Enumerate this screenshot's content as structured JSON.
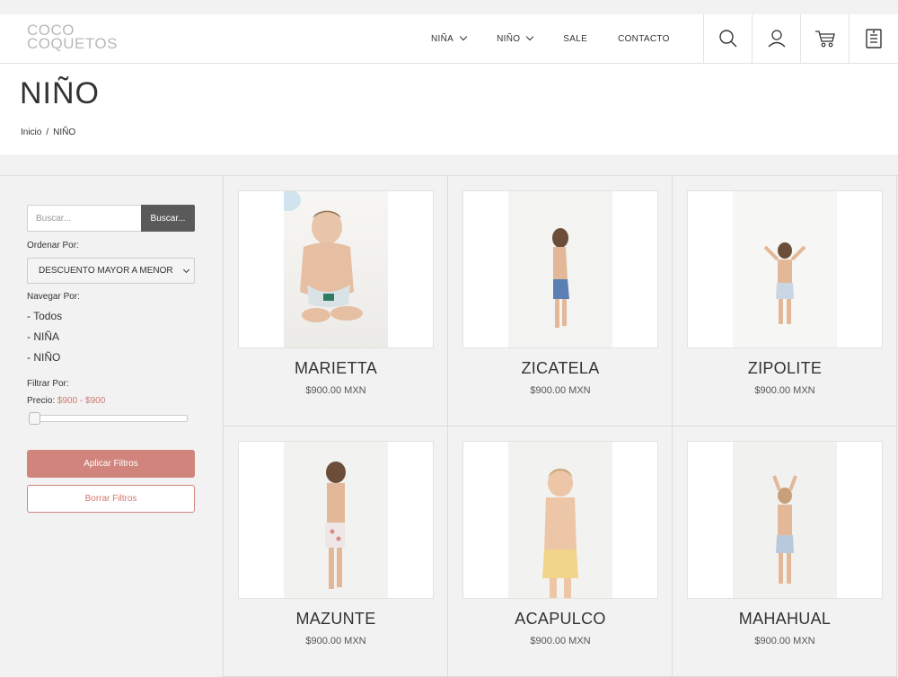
{
  "header": {
    "logo_line1": "COCO",
    "logo_line2": "COQUETOS",
    "nav": [
      {
        "label": "NIÑA",
        "dropdown": true
      },
      {
        "label": "NIÑO",
        "dropdown": true
      },
      {
        "label": "SALE",
        "dropdown": false
      },
      {
        "label": "CONTACTO",
        "dropdown": false
      }
    ],
    "icons": [
      "search-icon",
      "user-icon",
      "cart-icon",
      "wishlist-icon"
    ]
  },
  "page": {
    "title": "NIÑO",
    "breadcrumb": {
      "home": "Inicio",
      "separator": "/",
      "current": "NIÑO"
    }
  },
  "sidebar": {
    "search_placeholder": "Buscar...",
    "search_button": "Buscar...",
    "order_label": "Ordenar Por:",
    "order_selected": "DESCUENTO MAYOR A MENOR",
    "browse_label": "Navegar Por:",
    "browse_links": [
      "- Todos",
      "- NIÑA",
      "- NIÑO"
    ],
    "filter_label": "Filtrar Por:",
    "price_label": "Precio:",
    "price_range": "$900 - $900",
    "apply_button": "Aplicar Filtros",
    "clear_button": "Borrar Filtros"
  },
  "products": [
    {
      "name": "MARIETTA",
      "price": "$900.00 MXN"
    },
    {
      "name": "ZICATELA",
      "price": "$900.00 MXN"
    },
    {
      "name": "ZIPOLITE",
      "price": "$900.00 MXN"
    },
    {
      "name": "MAZUNTE",
      "price": "$900.00 MXN"
    },
    {
      "name": "ACAPULCO",
      "price": "$900.00 MXN"
    },
    {
      "name": "MAHAHUAL",
      "price": "$900.00 MXN"
    }
  ],
  "colors": {
    "accent": "#d0847b",
    "accent_text": "#d0786e",
    "search_button_bg": "#5a5a5a",
    "background": "#f2f2f2"
  }
}
